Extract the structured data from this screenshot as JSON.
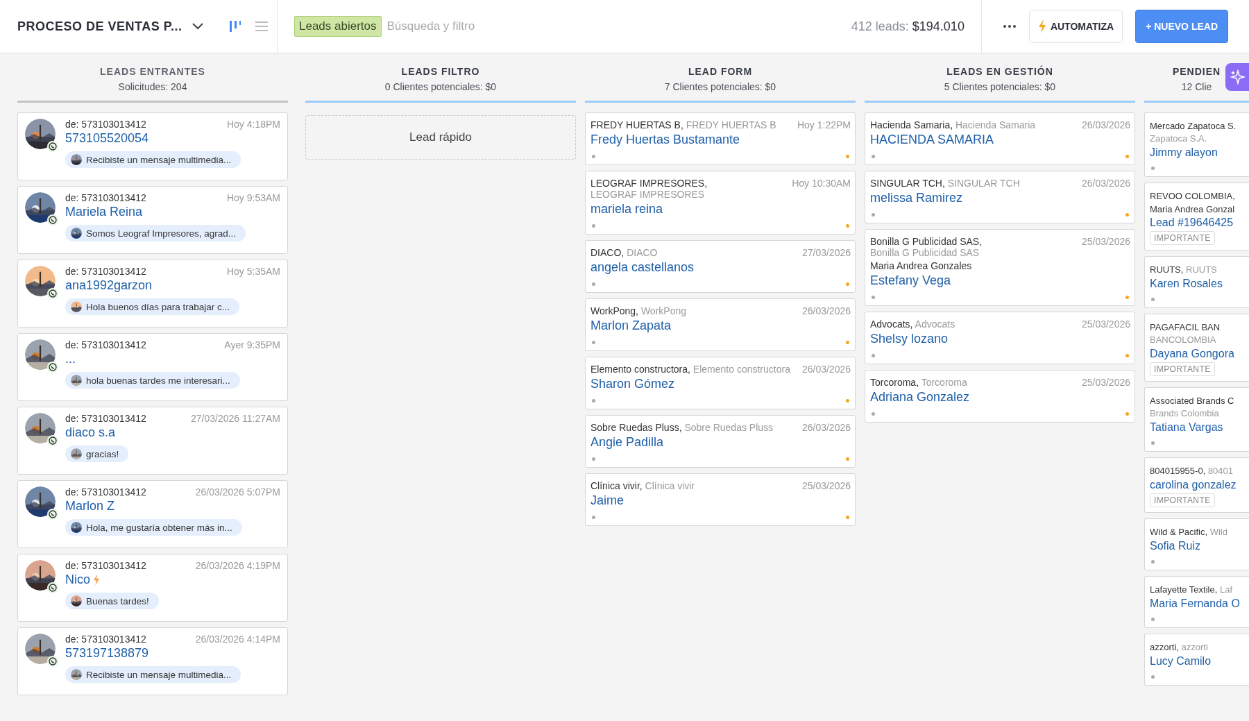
{
  "toolbar": {
    "pipeline_title": "PROCESO DE VENTAS P...",
    "views": [
      {
        "kind": "kanban",
        "selected": true
      },
      {
        "kind": "list",
        "selected": false
      }
    ],
    "filter_tag": "Leads abiertos",
    "search": {
      "placeholder": "Búsqueda y filtro"
    },
    "summary_label": "412 leads:",
    "summary_value": "$194.010",
    "automate_button": "AUTOMATIZA",
    "new_lead_button": "+ NUEVO LEAD"
  },
  "columns": [
    {
      "kind": "incoming",
      "title": "LEADS ENTRANTES",
      "subtitle": "Solicitudes: 204",
      "color": "#c4c4c4",
      "cards": [
        {
          "from": "de: 573103013412",
          "time": "Hoy 4:18PM",
          "name": "573105520054",
          "message": "Recibiste un mensaje multimedia...",
          "hot": false
        },
        {
          "from": "de: 573103013412",
          "time": "Hoy 9:53AM",
          "name": "Mariela Reina",
          "message": "Somos Leograf Impresores, agrad...",
          "hot": false
        },
        {
          "from": "de: 573103013412",
          "time": "Hoy 5:35AM",
          "name": "ana1992garzon",
          "message": "Hola buenos días para trabajar c...",
          "hot": false
        },
        {
          "from": "de: 573103013412",
          "time": "Ayer 9:35PM",
          "name": "...",
          "message": "hola buenas tardes me interesari...",
          "hot": false
        },
        {
          "from": "de: 573103013412",
          "time": "27/03/2026 11:27AM",
          "name": "diaco s.a",
          "message": "gracias!",
          "hot": false
        },
        {
          "from": "de: 573103013412",
          "time": "26/03/2026 5:07PM",
          "name": "Marlon Z",
          "message": "Hola, me gustaría obtener más in...",
          "hot": false
        },
        {
          "from": "de: 573103013412",
          "time": "26/03/2026 4:19PM",
          "name": "Nico",
          "message": "Buenas tardes!",
          "hot": true
        },
        {
          "from": "de: 573103013412",
          "time": "26/03/2026 4:14PM",
          "name": "573197138879",
          "message": "Recibiste un mensaje multimedia...",
          "hot": false
        }
      ]
    },
    {
      "kind": "quick",
      "title": "LEADS FILTRO",
      "subtitle": "0 Clientes potenciales: $0",
      "color": "#9ccbf7",
      "quick_add": "Lead rápido"
    },
    {
      "kind": "leads",
      "title": "LEAD FORM",
      "subtitle": "7 Clientes potenciales: $0",
      "color": "#9ccbf7",
      "cards": [
        {
          "company": "FREDY HUERTAS B,",
          "company_alt": "FREDY HUERTAS B",
          "date": "Hoy 1:22PM",
          "name": "Fredy Huertas Bustamante",
          "important": false
        },
        {
          "company": "LEOGRAF IMPRESORES,",
          "company_alt": "LEOGRAF IMPRESORES",
          "date": "Hoy 10:30AM",
          "name": "mariela reina",
          "important": false
        },
        {
          "company": "DIACO,",
          "company_alt": "DIACO",
          "date": "27/03/2026",
          "name": "angela castellanos",
          "important": false
        },
        {
          "company": "WorkPong,",
          "company_alt": "WorkPong",
          "date": "26/03/2026",
          "name": "Marlon Zapata",
          "important": false
        },
        {
          "company": "Elemento constructora,",
          "company_alt": "Elemento constructora",
          "date": "26/03/2026",
          "name": "Sharon Gómez",
          "important": false
        },
        {
          "company": "Sobre Ruedas Pluss,",
          "company_alt": "Sobre Ruedas Pluss",
          "date": "26/03/2026",
          "name": "Angie Padilla",
          "important": false
        },
        {
          "company": "Clínica vivir,",
          "company_alt": "Clínica vivir",
          "date": "25/03/2026",
          "name": "Jaime",
          "important": false
        }
      ]
    },
    {
      "kind": "leads",
      "title": "LEADS EN GESTIÓN",
      "subtitle": "5 Clientes potenciales: $0",
      "color": "#9ccbf7",
      "cards": [
        {
          "company": "Hacienda Samaria,",
          "company_alt": "Hacienda Samaria",
          "date": "26/03/2026",
          "name": "HACIENDA SAMARIA",
          "important": false
        },
        {
          "company": "SINGULAR TCH,",
          "company_alt": "SINGULAR TCH",
          "date": "26/03/2026",
          "name": "melissa Ramirez",
          "important": false
        },
        {
          "company": "Bonilla G Publicidad SAS,",
          "company_alt": "Bonilla G Publicidad SAS",
          "date": "25/03/2026",
          "contact": "Maria Andrea Gonzales",
          "name": "Estefany Vega",
          "important": false
        },
        {
          "company": "Advocats,",
          "company_alt": "Advocats",
          "date": "25/03/2026",
          "name": "Shelsy lozano",
          "important": false
        },
        {
          "company": "Torcoroma,",
          "company_alt": "Torcoroma",
          "date": "25/03/2026",
          "name": "Adriana Gonzalez",
          "important": false
        }
      ]
    },
    {
      "kind": "leads",
      "title": "PENDIEN",
      "subtitle": "12 Clie",
      "color": "#9ccbf7",
      "cards": [
        {
          "company": "Mercado Zapatoca S.",
          "company_alt": "Zapatoca S.A.",
          "name": "Jimmy alayon",
          "important": false
        },
        {
          "company": "REVOO COLOMBIA,",
          "contact": "Maria Andrea Gonzal",
          "name": "Lead #19646425",
          "important": true,
          "tag": "IMPORTANTE"
        },
        {
          "company": "RUUTS,",
          "company_alt": "RUUTS",
          "name": "Karen Rosales",
          "important": false
        },
        {
          "company": "PAGAFACIL BAN",
          "company_alt": "BANCOLOMBIA",
          "name": "Dayana Gongora",
          "important": true,
          "tag": "IMPORTANTE"
        },
        {
          "company": "Associated Brands C",
          "company_alt": "Brands Colombia",
          "name": "Tatiana Vargas",
          "important": false
        },
        {
          "company": "804015955-0,",
          "company_alt": "80401",
          "name": "carolina gonzalez",
          "important": true,
          "tag": "IMPORTANTE"
        },
        {
          "company": "Wild & Pacific,",
          "company_alt": "Wild",
          "name": "Sofia Ruiz",
          "important": false
        },
        {
          "company": "Lafayette Textile,",
          "company_alt": "Laf",
          "name": "Maria Fernanda O",
          "important": false
        },
        {
          "company": "azzorti,",
          "company_alt": "azzorti",
          "name": "Lucy Camilo",
          "important": false
        }
      ]
    }
  ]
}
